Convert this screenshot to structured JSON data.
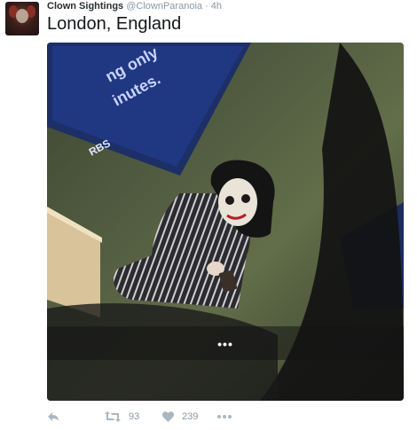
{
  "tweet": {
    "display_name": "Clown Sightings",
    "handle": "@ClownParanoia",
    "separator": "·",
    "time": "4h",
    "text": "London, England",
    "media": {
      "overlay_dots": "•••"
    },
    "actions": {
      "reply_icon": "reply-icon",
      "retweet_icon": "retweet-icon",
      "retweet_count": "93",
      "like_icon": "heart-icon",
      "like_count": "239",
      "more_icon": "more-icon"
    }
  },
  "colors": {
    "text": "#292f33",
    "muted": "#8899a6"
  }
}
